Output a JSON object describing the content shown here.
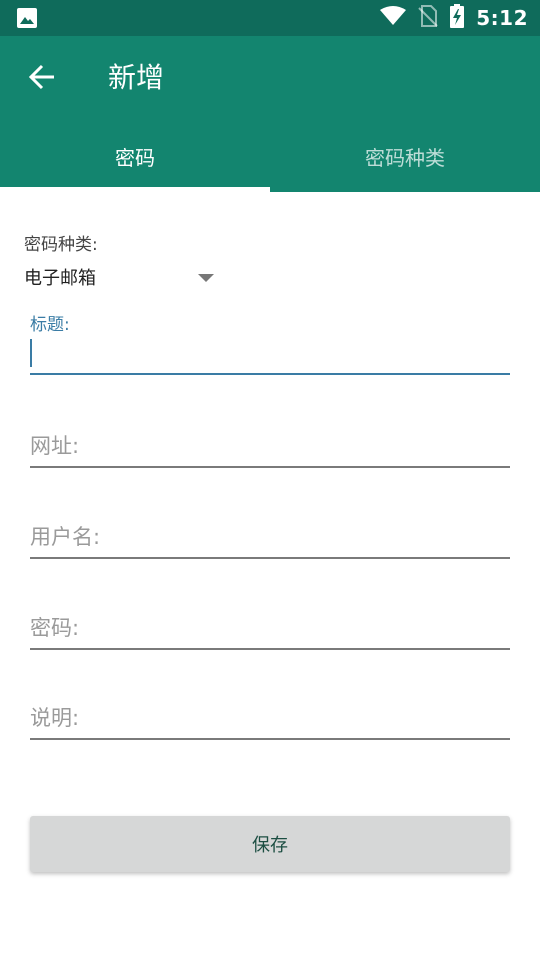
{
  "status_bar": {
    "time": "5:12",
    "icons": [
      "image-icon",
      "wifi-icon",
      "no-sim-icon",
      "battery-charging-icon"
    ]
  },
  "app_bar": {
    "title": "新增",
    "back_icon": "back-arrow-icon"
  },
  "tabs": [
    {
      "label": "密码",
      "selected": true
    },
    {
      "label": "密码种类",
      "selected": false
    }
  ],
  "form": {
    "category_label": "密码种类:",
    "category_value": "电子邮箱",
    "title_label": "标题:",
    "title_value": "",
    "url_placeholder": "网址:",
    "username_placeholder": "用户名:",
    "password_placeholder": "密码:",
    "notes_placeholder": "说明:",
    "save_label": "保存"
  },
  "colors": {
    "status_bar": "#0f6b5b",
    "app_bar": "#13856f",
    "accent": "#3a7ca5",
    "button_bg": "#d6d7d7"
  }
}
